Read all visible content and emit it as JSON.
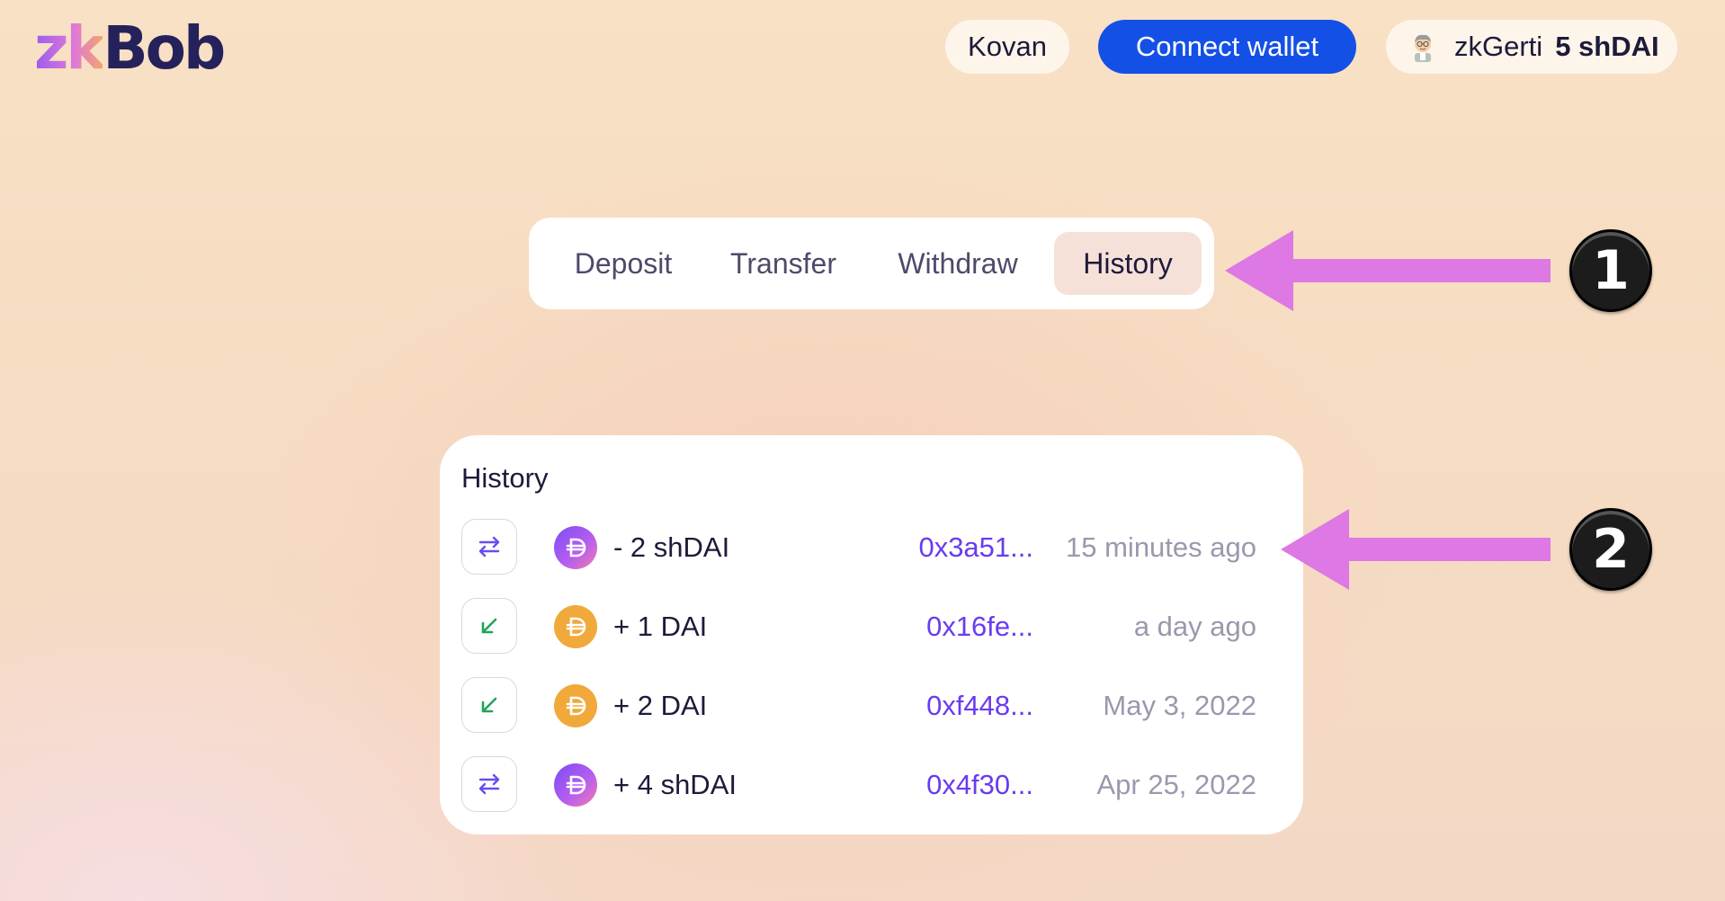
{
  "header": {
    "logo_prefix": "zk",
    "logo_suffix": "Bob",
    "network": "Kovan",
    "connect_label": "Connect wallet",
    "account_name": "zkGerti",
    "account_balance": "5 shDAI"
  },
  "tabs": [
    {
      "label": "Deposit",
      "active": false
    },
    {
      "label": "Transfer",
      "active": false
    },
    {
      "label": "Withdraw",
      "active": false
    },
    {
      "label": "History",
      "active": true
    }
  ],
  "history": {
    "title": "History",
    "rows": [
      {
        "type_icon": "transfer-icon",
        "token": "shDAI",
        "amount": "- 2 shDAI",
        "hash": "0x3a51...",
        "time": "15 minutes ago"
      },
      {
        "type_icon": "deposit-icon",
        "token": "DAI",
        "amount": "+ 1 DAI",
        "hash": "0x16fe...",
        "time": "a day ago"
      },
      {
        "type_icon": "deposit-icon",
        "token": "DAI",
        "amount": "+ 2 DAI",
        "hash": "0xf448...",
        "time": "May 3, 2022"
      },
      {
        "type_icon": "transfer-icon",
        "token": "shDAI",
        "amount": "+ 4 shDAI",
        "hash": "0x4f30...",
        "time": "Apr 25, 2022"
      }
    ]
  },
  "annotations": {
    "badge_1": "1",
    "badge_2": "2"
  },
  "colors": {
    "accent_blue": "#1450e6",
    "hash_purple": "#6a3bf0",
    "annotation_pink": "#dd78e4",
    "deposit_green": "#22a35a",
    "transfer_purple": "#6a4cf0",
    "dai_orange": "#f0a93a"
  }
}
